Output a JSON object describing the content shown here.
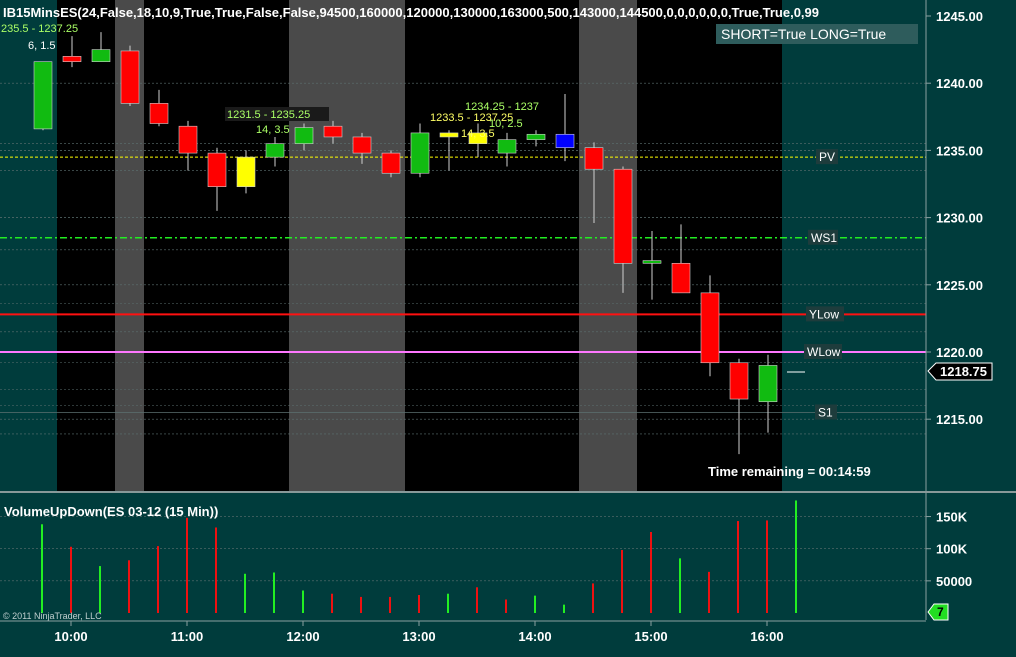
{
  "theme": {
    "background": "#003c3c",
    "session_bg": "#000000",
    "shade_bg": "#4a4a4a",
    "up_color": "#11bb11",
    "down_color": "#ff0000",
    "yellow_bar": "#ffff00",
    "blue_bar": "#0000ff",
    "grid_line": "#5c7070",
    "text_light": "#ffffff",
    "text_yellow": "#ffff66",
    "text_green": "#aaff66",
    "pv_color": "#ffff00",
    "ws1_color": "#22ee22",
    "ylow_color": "#ff1111",
    "wlow_color": "#ff77ff"
  },
  "price_panel": {
    "indicator_title": "IB15MinsES(24,False,18,10,9,True,True,False,False,94500,160000,120000,130000,163000,500,143000,144500,0,0,0,0,0,0,True,True,0,99",
    "status_text": "SHORT=True LONG=True",
    "time_remaining": "Time remaining = 00:14:59",
    "last_price_label": "1218.75",
    "ib_labels": [
      "235.5 - 1237.25",
      "6, 1.5",
      "1231.5 - 1235.25",
      "14, 3.5",
      "1233.5 - 1237.25",
      "14, 3.5",
      "1234.25 - 1237",
      "10, 2.5"
    ]
  },
  "volume_panel": {
    "title": "VolumeUpDown(ES 03-12 (15 Min))",
    "badge": "7",
    "copyright": "© 2011 NinjaTrader, LLC"
  },
  "chart_data": [
    {
      "type": "candlestick",
      "yaxis_ticks": [
        "1245.00",
        "1240.00",
        "1235.00",
        "1230.00",
        "1225.00",
        "1220.00",
        "1215.00"
      ],
      "ylim": [
        1211.5,
        1245.0
      ],
      "last_price": 1218.75,
      "candles": [
        {
          "o": 1236.6,
          "h": 1241.6,
          "l": 1236.5,
          "c": 1241.6,
          "color": "up"
        },
        {
          "o": 1242.0,
          "h": 1243.5,
          "l": 1241.2,
          "c": 1241.6,
          "color": "down"
        },
        {
          "o": 1241.6,
          "h": 1243.8,
          "l": 1241.6,
          "c": 1242.5,
          "color": "up"
        },
        {
          "o": 1242.4,
          "h": 1242.8,
          "l": 1238.3,
          "c": 1238.5,
          "color": "down"
        },
        {
          "o": 1238.5,
          "h": 1239.5,
          "l": 1236.8,
          "c": 1237.0,
          "color": "down"
        },
        {
          "o": 1236.8,
          "h": 1237.2,
          "l": 1233.5,
          "c": 1234.8,
          "color": "down"
        },
        {
          "o": 1234.8,
          "h": 1235.2,
          "l": 1230.5,
          "c": 1232.3,
          "color": "down"
        },
        {
          "o": 1232.3,
          "h": 1235.0,
          "l": 1231.8,
          "c": 1234.5,
          "color": "yellow"
        },
        {
          "o": 1234.5,
          "h": 1236.0,
          "l": 1233.8,
          "c": 1235.5,
          "color": "up"
        },
        {
          "o": 1235.5,
          "h": 1237.0,
          "l": 1235.0,
          "c": 1236.7,
          "color": "up"
        },
        {
          "o": 1236.8,
          "h": 1237.2,
          "l": 1235.5,
          "c": 1236.0,
          "color": "down"
        },
        {
          "o": 1236.0,
          "h": 1236.3,
          "l": 1234.0,
          "c": 1234.8,
          "color": "down"
        },
        {
          "o": 1234.8,
          "h": 1235.0,
          "l": 1233.0,
          "c": 1233.3,
          "color": "down"
        },
        {
          "o": 1233.3,
          "h": 1237.0,
          "l": 1233.0,
          "c": 1236.3,
          "color": "up"
        },
        {
          "o": 1236.0,
          "h": 1236.5,
          "l": 1233.5,
          "c": 1236.3,
          "color": "yellow"
        },
        {
          "o": 1235.5,
          "h": 1237.0,
          "l": 1234.5,
          "c": 1236.3,
          "color": "yellow"
        },
        {
          "o": 1234.8,
          "h": 1236.3,
          "l": 1233.8,
          "c": 1235.8,
          "color": "up"
        },
        {
          "o": 1235.8,
          "h": 1236.5,
          "l": 1235.3,
          "c": 1236.2,
          "color": "up"
        },
        {
          "o": 1236.2,
          "h": 1239.2,
          "l": 1234.2,
          "c": 1235.2,
          "color": "blue"
        },
        {
          "o": 1235.2,
          "h": 1235.6,
          "l": 1229.6,
          "c": 1233.6,
          "color": "down"
        },
        {
          "o": 1233.6,
          "h": 1233.8,
          "l": 1224.4,
          "c": 1226.6,
          "color": "down"
        },
        {
          "o": 1226.8,
          "h": 1229.0,
          "l": 1223.9,
          "c": 1226.6,
          "color": "up"
        },
        {
          "o": 1226.6,
          "h": 1229.5,
          "l": 1224.4,
          "c": 1224.4,
          "color": "down"
        },
        {
          "o": 1224.4,
          "h": 1225.7,
          "l": 1218.2,
          "c": 1219.2,
          "color": "down"
        },
        {
          "o": 1219.2,
          "h": 1219.5,
          "l": 1212.4,
          "c": 1216.5,
          "color": "down"
        },
        {
          "o": 1216.3,
          "h": 1219.8,
          "l": 1214.0,
          "c": 1219.0,
          "color": "up"
        }
      ],
      "levels": [
        {
          "name": "PV",
          "price": 1234.5,
          "style": "dashed",
          "color_key": "pv_color"
        },
        {
          "name": "WS1",
          "price": 1228.5,
          "style": "dashdot",
          "color_key": "ws1_color"
        },
        {
          "name": "YLow",
          "price": 1222.8,
          "style": "solid",
          "color_key": "ylow_color"
        },
        {
          "name": "WLow",
          "price": 1220.0,
          "style": "solid",
          "color_key": "wlow_color"
        },
        {
          "name": "S1",
          "price": 1215.5,
          "style": "solid",
          "color_key": "grid_line"
        }
      ]
    },
    {
      "type": "bar",
      "yaxis_ticks": [
        "150K",
        "100K",
        "50000"
      ],
      "ylim": [
        0,
        180000
      ],
      "xaxis_ticks": [
        "10:00",
        "11:00",
        "12:00",
        "13:00",
        "14:00",
        "15:00",
        "16:00"
      ],
      "volumes": [
        {
          "v": 138000,
          "color": "up"
        },
        {
          "v": 103000,
          "color": "down"
        },
        {
          "v": 73000,
          "color": "up"
        },
        {
          "v": 82000,
          "color": "down"
        },
        {
          "v": 104000,
          "color": "down"
        },
        {
          "v": 148000,
          "color": "down"
        },
        {
          "v": 133000,
          "color": "down"
        },
        {
          "v": 61000,
          "color": "up"
        },
        {
          "v": 63000,
          "color": "up"
        },
        {
          "v": 35000,
          "color": "up"
        },
        {
          "v": 30000,
          "color": "down"
        },
        {
          "v": 25000,
          "color": "down"
        },
        {
          "v": 25000,
          "color": "down"
        },
        {
          "v": 28000,
          "color": "down"
        },
        {
          "v": 30000,
          "color": "up"
        },
        {
          "v": 40000,
          "color": "down"
        },
        {
          "v": 21000,
          "color": "down"
        },
        {
          "v": 27000,
          "color": "up"
        },
        {
          "v": 13000,
          "color": "up"
        },
        {
          "v": 46000,
          "color": "down"
        },
        {
          "v": 98000,
          "color": "down"
        },
        {
          "v": 126000,
          "color": "down"
        },
        {
          "v": 85000,
          "color": "up"
        },
        {
          "v": 64000,
          "color": "down"
        },
        {
          "v": 143000,
          "color": "down"
        },
        {
          "v": 144000,
          "color": "down"
        },
        {
          "v": 175000,
          "color": "up"
        }
      ]
    }
  ]
}
